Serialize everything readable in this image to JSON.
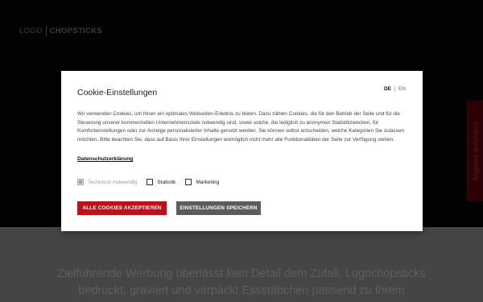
{
  "background": {
    "logo": {
      "light": "LOGO",
      "bold": "CHOPSTICKS"
    },
    "side_tab": "Angebot anfordern",
    "headline": "Zielführende Werbung überlässt kein Detail dem Zufall. Logochopsticks bedruckt, graviert und verpackt Essstäbchen passend zu Ihrem"
  },
  "modal": {
    "title": "Cookie-Einstellungen",
    "languages": [
      {
        "code": "DE",
        "active": true
      },
      {
        "code": "EN",
        "active": false
      }
    ],
    "description": "Wir verwenden Cookies, um Ihnen ein optimales Webseiten-Erlebnis zu bieten. Dazu zählen Cookies, die für den Betrieb der Seite und für die Steuerung unserer kommerziellen Unternehmensziele notwendig sind, sowie solche, die lediglich zu anonymen Statistikzwecken, für Komforteinstellungen oder zur Anzeige personalisierter Inhalte genutzt werden. Sie können selbst entscheiden, welche Kategorien Sie zulassen möchten. Bitte beachten Sie, dass auf Basis Ihrer Einstellungen womöglich nicht mehr alle Funktionalitäten der Seite zur Verfügung stehen.",
    "privacy_link": "Datenschutzerklärung",
    "checkboxes": [
      {
        "label": "Technisch notwendig",
        "checked": true,
        "disabled": true
      },
      {
        "label": "Statistik",
        "checked": false,
        "disabled": false
      },
      {
        "label": "Marketing",
        "checked": false,
        "disabled": false
      }
    ],
    "accept_all_label": "ALLE COOKIES AKZEPTIEREN",
    "save_label": "EINSTELLUNGEN SPEICHERN"
  },
  "colors": {
    "accent_red": "#b8141c",
    "button_gray": "#5c5c5c"
  }
}
